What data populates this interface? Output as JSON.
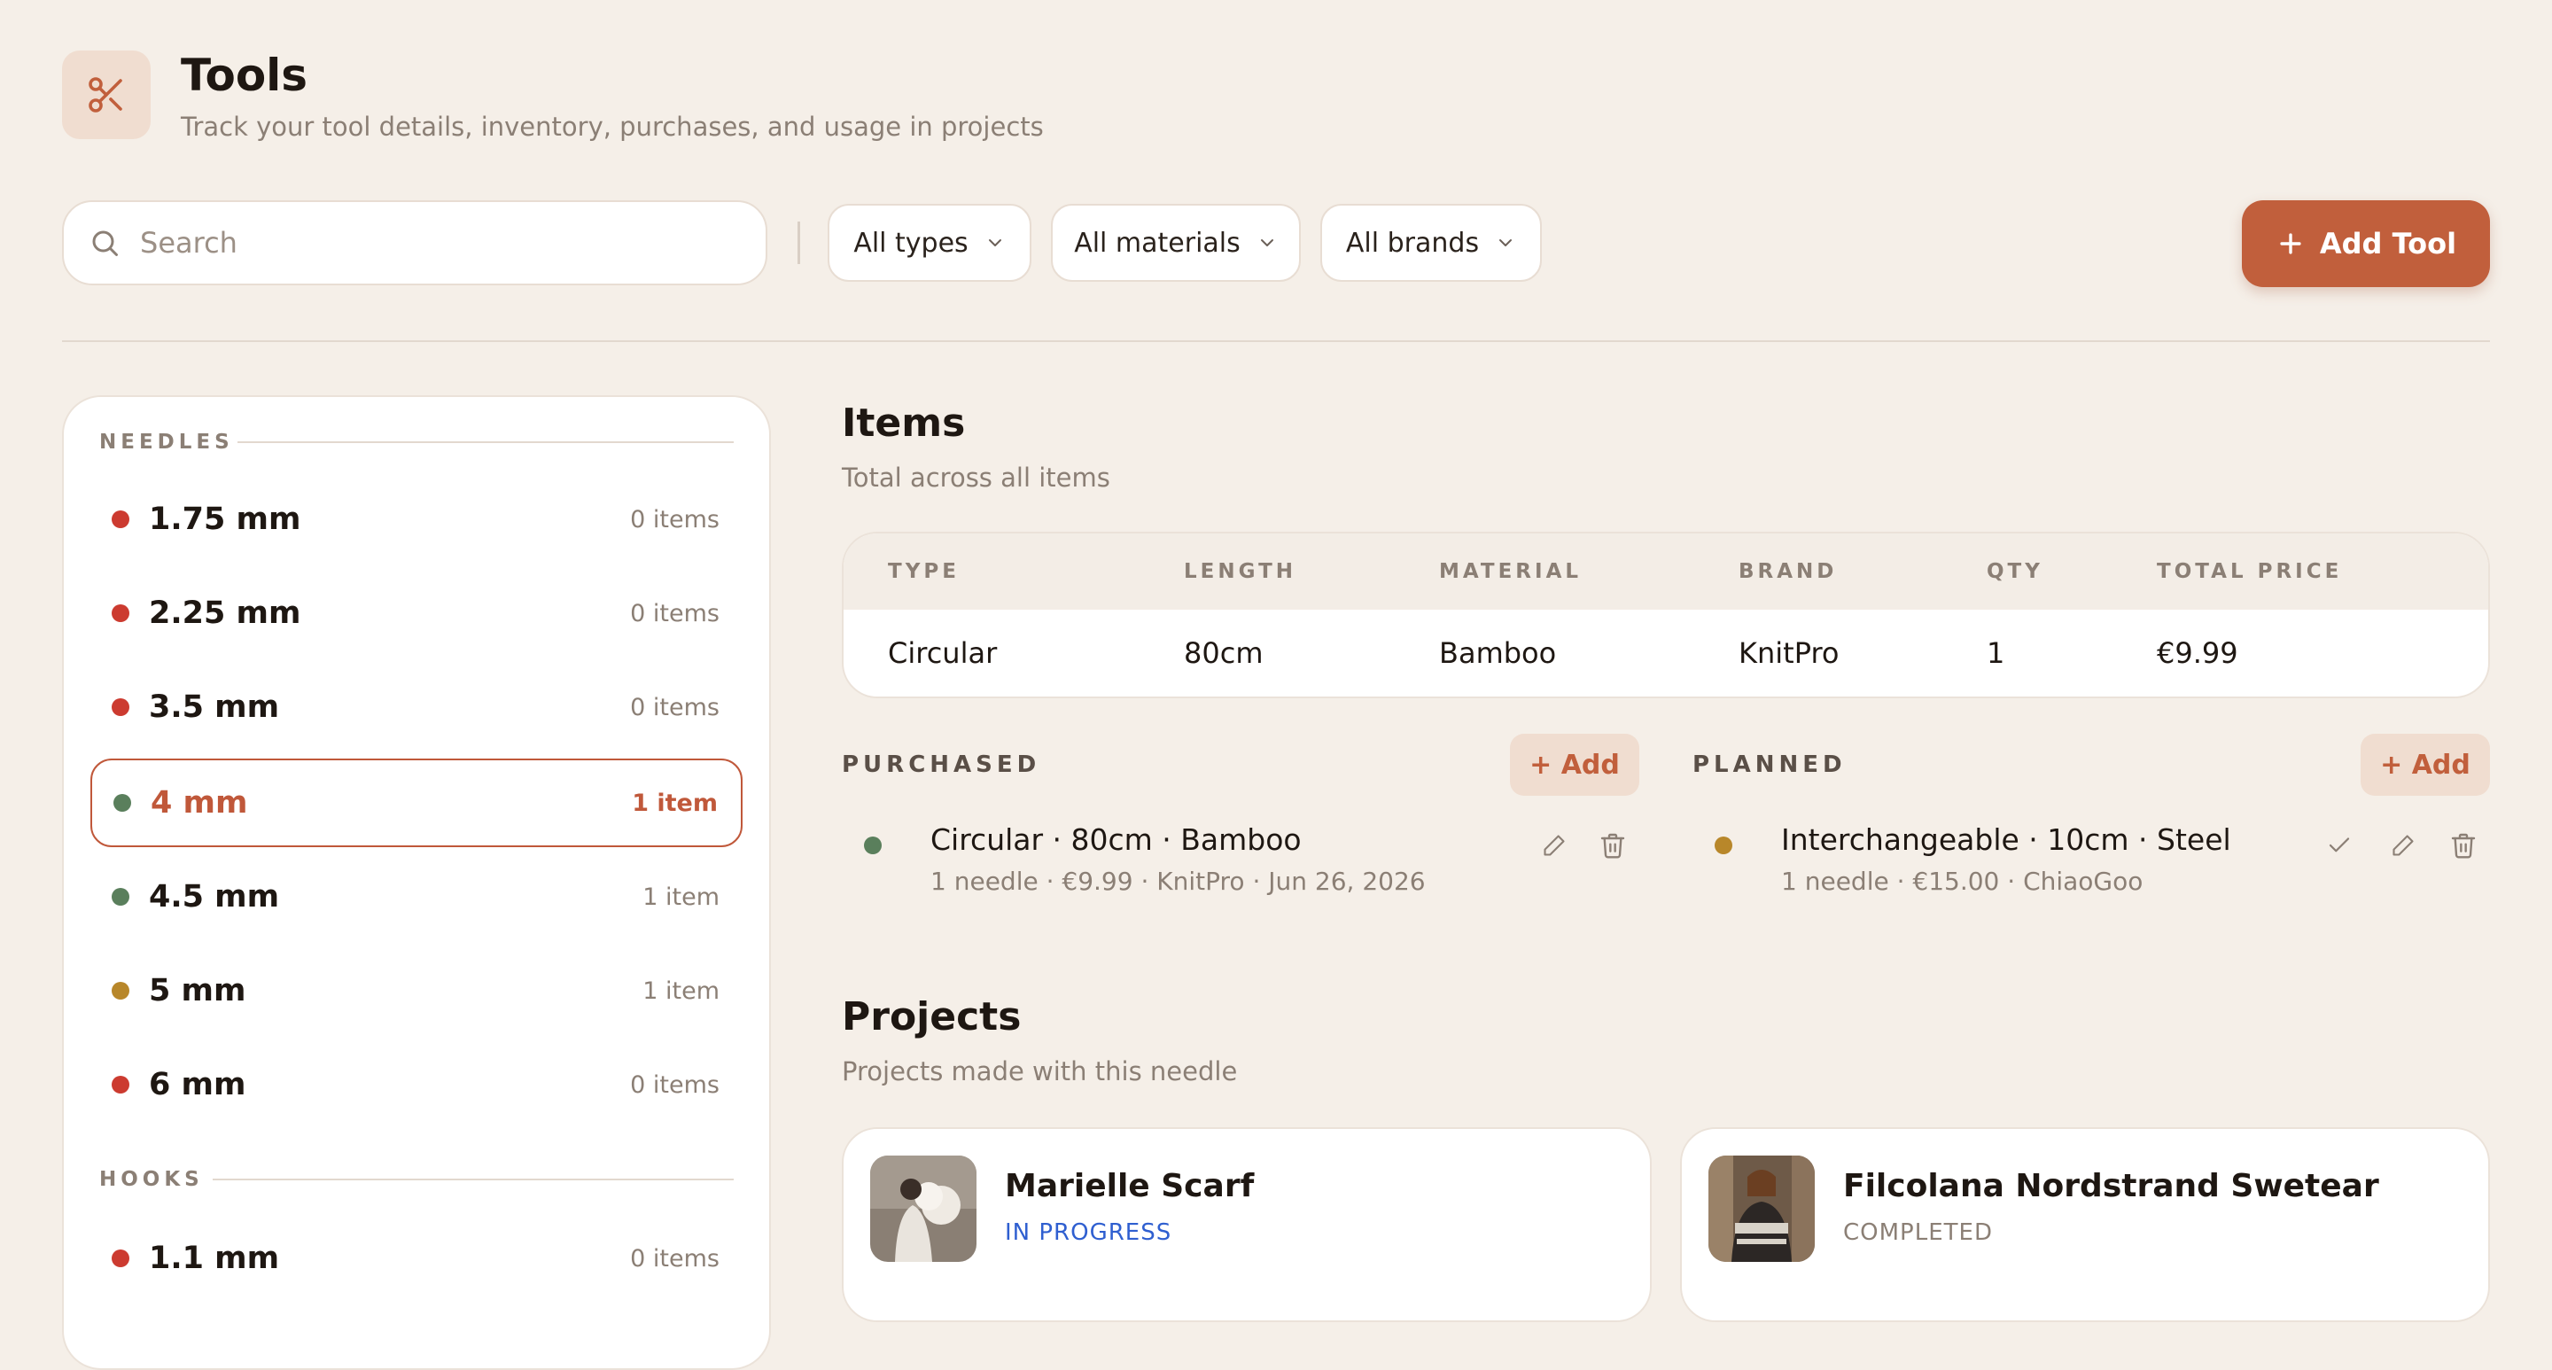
{
  "header": {
    "title": "Tools",
    "subtitle": "Track your tool details, inventory, purchases, and usage in projects"
  },
  "toolbar": {
    "search_placeholder": "Search",
    "filters": [
      "All types",
      "All materials",
      "All brands"
    ],
    "add_tool_label": "Add Tool"
  },
  "sidebar": {
    "needles_label": "NEEDLES",
    "hooks_label": "HOOKS",
    "needles": [
      {
        "size": "1.75 mm",
        "count": "0 items",
        "status_color": "#cc3b30"
      },
      {
        "size": "2.25 mm",
        "count": "0 items",
        "status_color": "#cc3b30"
      },
      {
        "size": "3.5 mm",
        "count": "0 items",
        "status_color": "#cc3b30"
      },
      {
        "size": "4 mm",
        "count": "1 item",
        "status_color": "#5a7f5c",
        "selected": true
      },
      {
        "size": "4.5 mm",
        "count": "1 item",
        "status_color": "#5a7f5c"
      },
      {
        "size": "5 mm",
        "count": "1 item",
        "status_color": "#b8872a"
      },
      {
        "size": "6 mm",
        "count": "0 items",
        "status_color": "#cc3b30"
      }
    ],
    "hooks": [
      {
        "size": "1.1 mm",
        "count": "0 items",
        "status_color": "#cc3b30"
      }
    ]
  },
  "items": {
    "title": "Items",
    "subtitle": "Total across all items",
    "columns": [
      "TYPE",
      "LENGTH",
      "MATERIAL",
      "BRAND",
      "QTY",
      "TOTAL PRICE"
    ],
    "rows": [
      [
        "Circular",
        "80cm",
        "Bamboo",
        "KnitPro",
        "1",
        "€9.99"
      ]
    ]
  },
  "purchased": {
    "label": "PURCHASED",
    "add_label": "+ Add",
    "entries": [
      {
        "title": "Circular · 80cm · Bamboo",
        "meta": "1 needle · €9.99 · KnitPro · Jun 26, 2026",
        "status_color": "#5a7f5c"
      }
    ]
  },
  "planned": {
    "label": "PLANNED",
    "add_label": "+ Add",
    "entries": [
      {
        "title": "Interchangeable · 10cm · Steel",
        "meta": "1 needle · €15.00 · ChiaoGoo",
        "status_color": "#b8872a"
      }
    ]
  },
  "projects": {
    "title": "Projects",
    "subtitle": "Projects made with this needle",
    "cards": [
      {
        "name": "Marielle Scarf",
        "status": "IN PROGRESS",
        "status_color": "#2f5fd0"
      },
      {
        "name": "Filcolana Nordstrand Swetear",
        "status": "COMPLETED",
        "status_color": "#8b7f75"
      }
    ]
  },
  "colors": {
    "accent": "#c15f3c",
    "background": "#f5efe8"
  }
}
